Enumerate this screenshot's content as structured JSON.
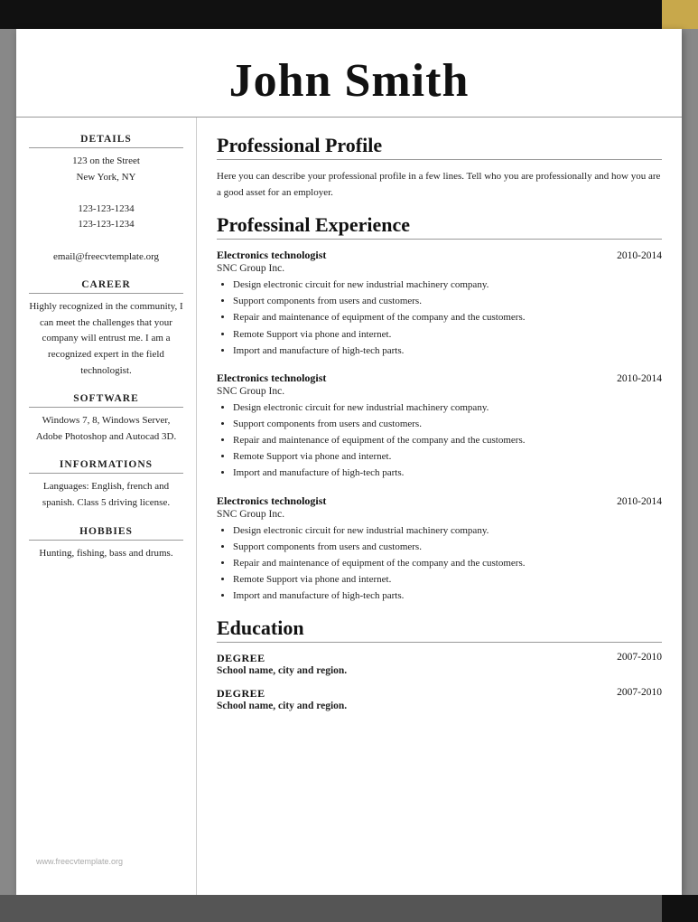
{
  "header": {
    "name": "John Smith"
  },
  "sidebar": {
    "details_title": "DETAILS",
    "address_line1": "123 on the Street",
    "address_line2": "New York, NY",
    "phone1": "123-123-1234",
    "phone2": "123-123-1234",
    "email": "email@freecvtemplate.org",
    "career_title": "CAREER",
    "career_text": "Highly recognized in the community, I can meet the challenges that your company will entrust me. I am a recognized expert in the field technologist.",
    "software_title": "SOFTWARE",
    "software_text": "Windows 7, 8, Windows Server, Adobe Photoshop and Autocad 3D.",
    "informations_title": "INFORMATIONS",
    "informations_text": "Languages: English, french and spanish. Class 5 driving license.",
    "hobbies_title": "HOBBIES",
    "hobbies_text": "Hunting, fishing, bass and drums."
  },
  "profile": {
    "section_title": "Professional Profile",
    "text": "Here you can describe your professional profile in a few lines. Tell who you are professionally and how you are a good asset for an employer."
  },
  "experience": {
    "section_title": "Professinal Experience",
    "jobs": [
      {
        "title": "Electronics technologist",
        "years": "2010-2014",
        "company": "SNC Group Inc.",
        "duties": [
          "Design electronic circuit for new industrial machinery company.",
          "Support components from users and customers.",
          "Repair and maintenance of equipment of the company and the customers.",
          "Remote Support via phone and internet.",
          "Import and manufacture of high-tech parts."
        ]
      },
      {
        "title": "Electronics technologist",
        "years": "2010-2014",
        "company": "SNC Group Inc.",
        "duties": [
          "Design electronic circuit for new industrial machinery company.",
          "Support components from users and customers.",
          "Repair and maintenance of equipment of the company and the customers.",
          "Remote Support via phone and internet.",
          "Import and manufacture of high-tech parts."
        ]
      },
      {
        "title": "Electronics technologist",
        "years": "2010-2014",
        "company": "SNC Group Inc.",
        "duties": [
          "Design electronic circuit for new industrial machinery company.",
          "Support components from users and customers.",
          "Repair and maintenance of equipment of the company and the customers.",
          "Remote Support via phone and internet.",
          "Import and manufacture of high-tech parts."
        ]
      }
    ]
  },
  "education": {
    "section_title": "Education",
    "entries": [
      {
        "degree": "DEGREE",
        "years": "2007-2010",
        "school": "School name, city and region."
      },
      {
        "degree": "DEGREE",
        "years": "2007-2010",
        "school": "School name, city and region."
      }
    ]
  },
  "watermark": "www.freecvtemplate.org"
}
